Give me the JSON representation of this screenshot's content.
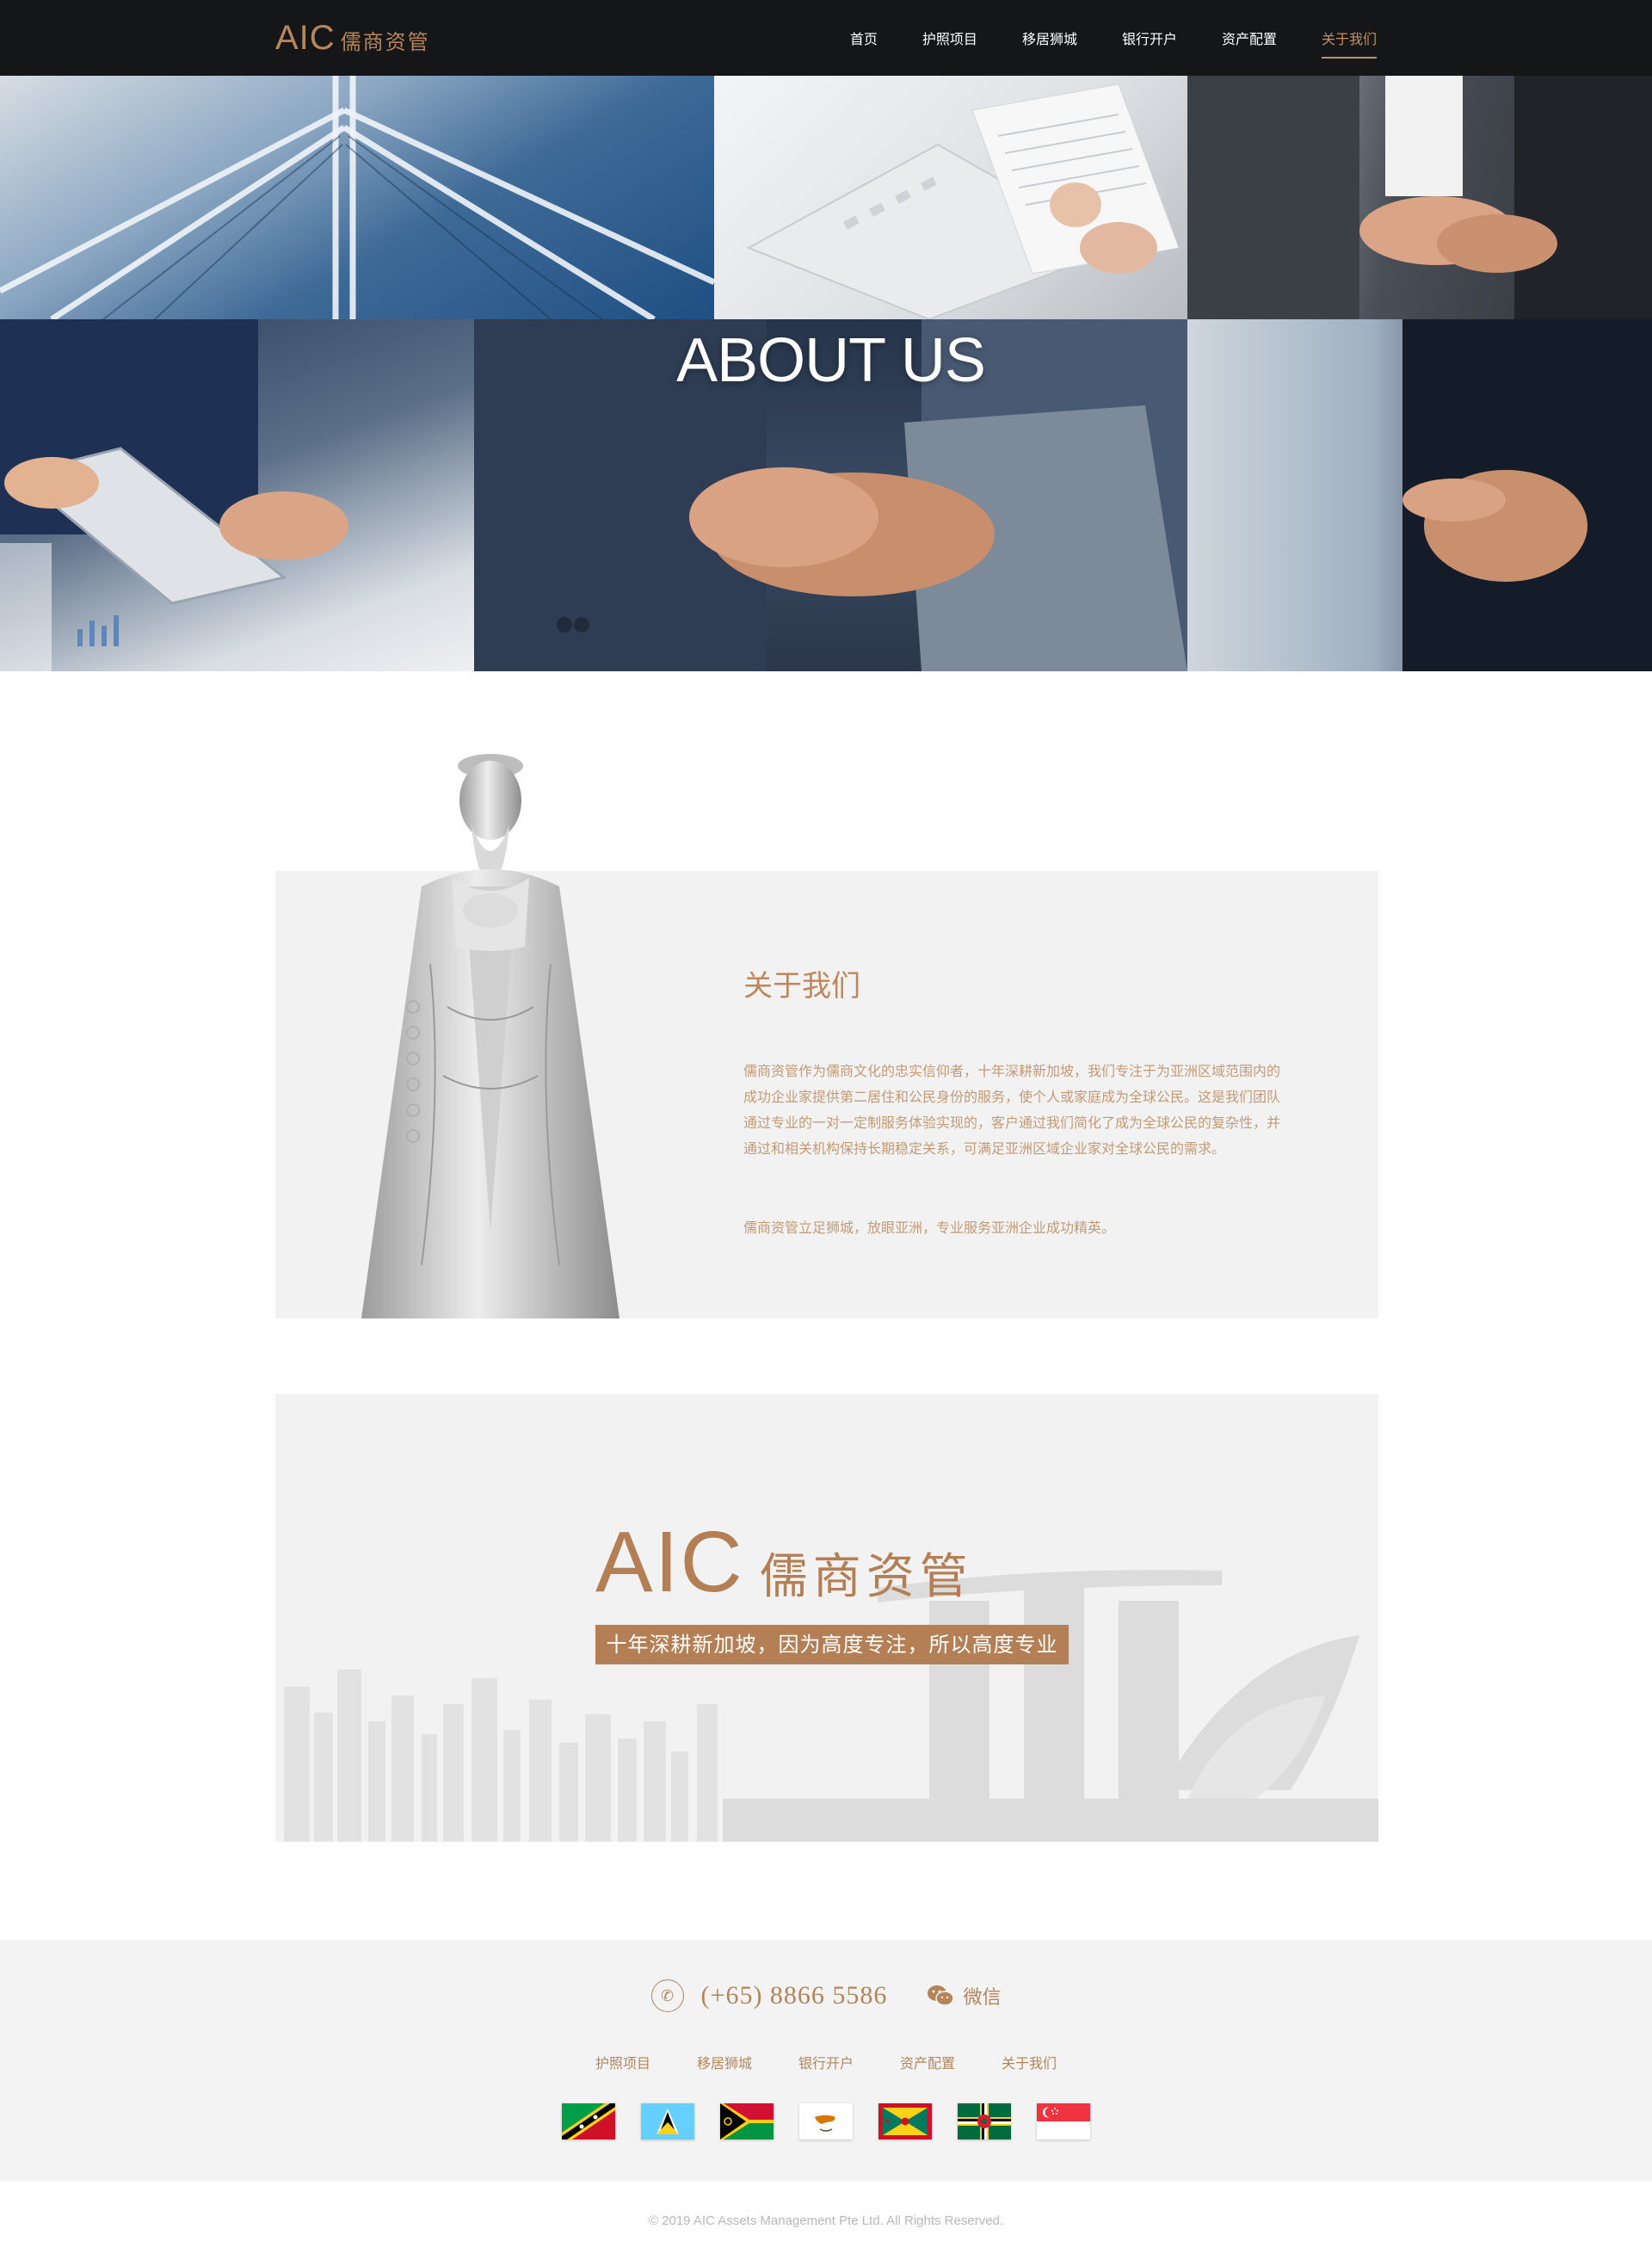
{
  "header": {
    "logo_en": "AIC",
    "logo_cn": "儒商资管",
    "nav": [
      {
        "label": "首页"
      },
      {
        "label": "护照项目"
      },
      {
        "label": "移居狮城"
      },
      {
        "label": "银行开户"
      },
      {
        "label": "资产配置"
      },
      {
        "label": "关于我们",
        "active": true
      }
    ]
  },
  "hero": {
    "title": "ABOUT US"
  },
  "about": {
    "title": "关于我们",
    "paragraph1": "儒商资管作为儒商文化的忠实信仰者，十年深耕新加坡，我们专注于为亚洲区域范围内的成功企业家提供第二居住和公民身份的服务，使个人或家庭成为全球公民。这是我们团队通过专业的一对一定制服务体验实现的，客户通过我们简化了成为全球公民的复杂性，并通过和相关机构保持长期稳定关系，可满足亚洲区域企业家对全球公民的需求。",
    "paragraph2": "儒商资管立足狮城，放眼亚洲，专业服务亚洲企业成功精英。"
  },
  "banner": {
    "logo_en": "AIC",
    "logo_cn": "儒商资管",
    "slogan": "十年深耕新加坡，因为高度专注，所以高度专业"
  },
  "footer": {
    "phone": "(+65) 8866 5586",
    "wechat_label": "微信",
    "nav": [
      "护照项目",
      "移居狮城",
      "银行开户",
      "资产配置",
      "关于我们"
    ],
    "flags": [
      "saint-kitts-and-nevis-flag",
      "saint-lucia-flag",
      "vanuatu-flag",
      "cyprus-flag",
      "grenada-flag",
      "dominica-flag",
      "singapore-flag"
    ],
    "copyright": "© 2019 AIC Assets Management Pte Ltd. All Rights Reserved."
  },
  "colors": {
    "accent": "#c39063",
    "brand": "#b47f55",
    "header_bg": "#141414",
    "panel_bg": "#f2f2f2"
  }
}
